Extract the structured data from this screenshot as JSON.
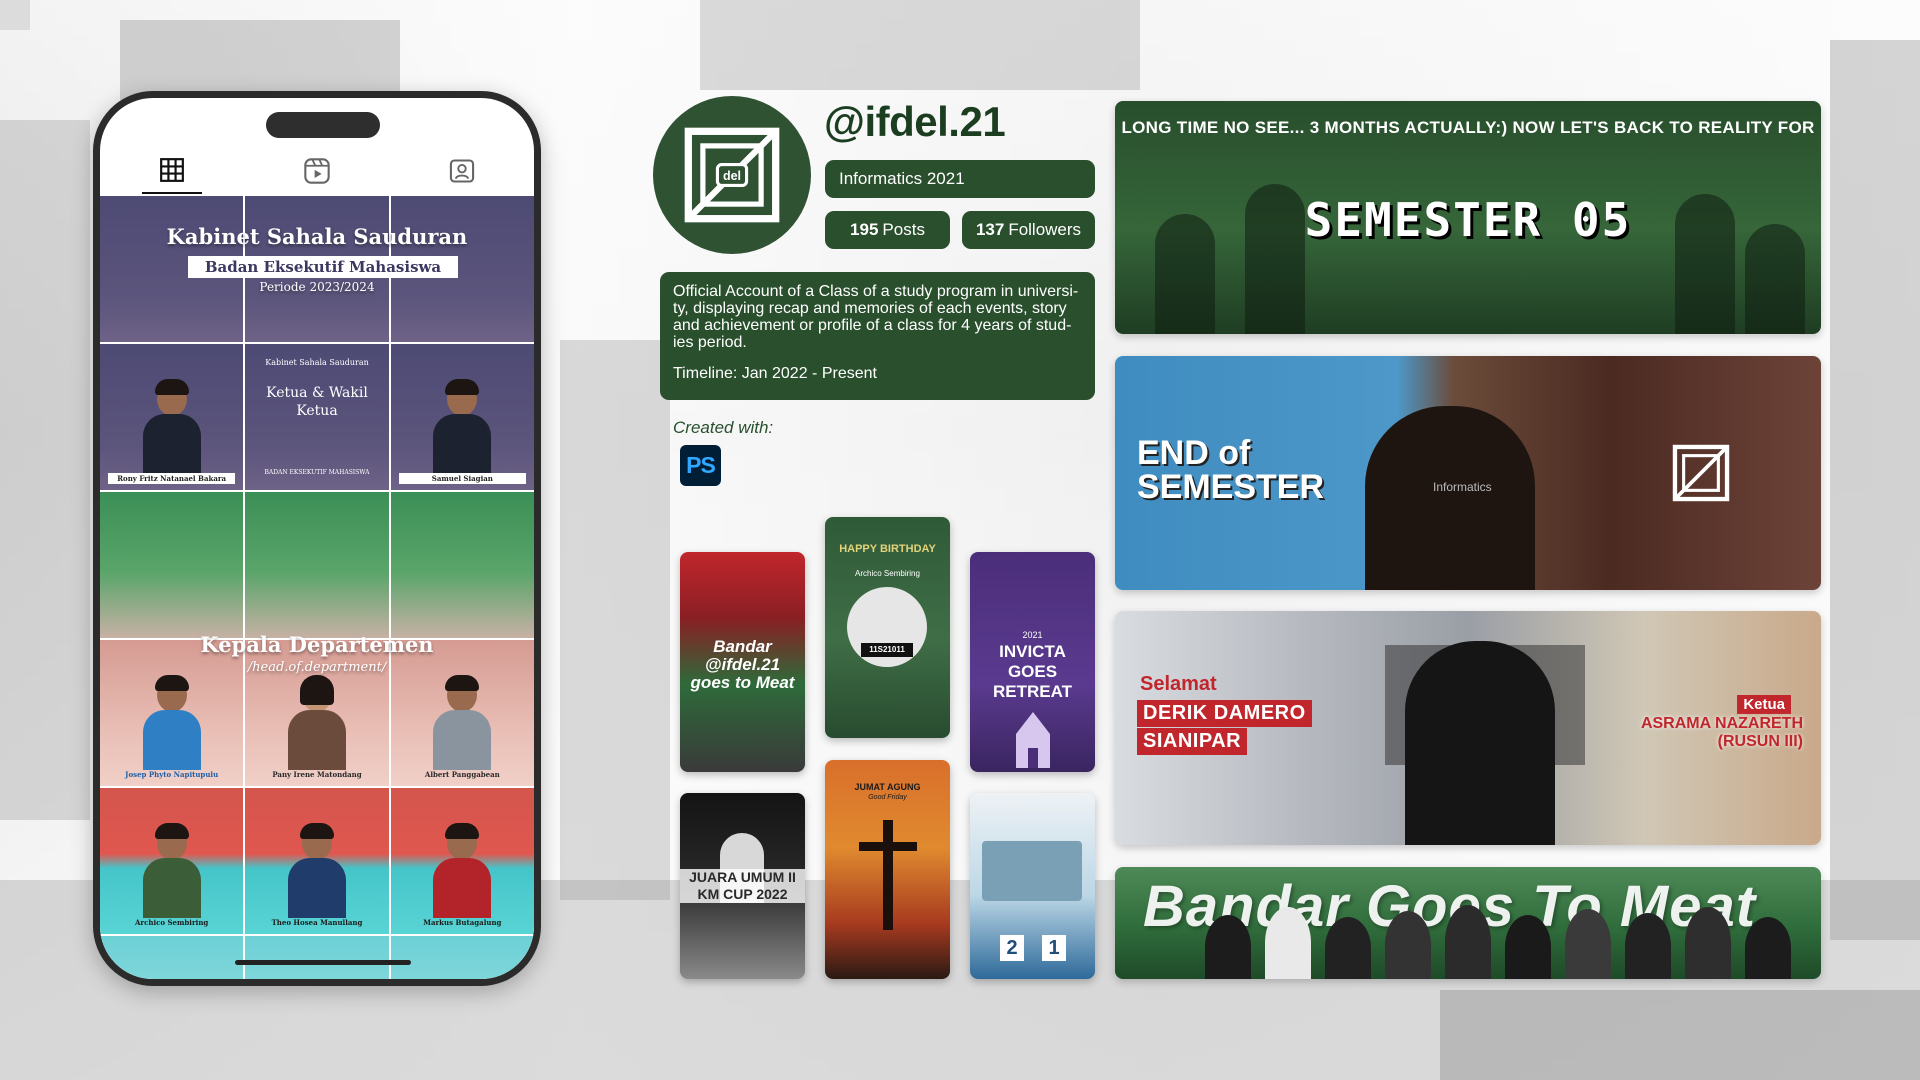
{
  "profile": {
    "handle": "@ifdel.21",
    "subtitle": "Informatics 2021",
    "posts_count": "195",
    "posts_label": "Posts",
    "followers_count": "137",
    "followers_label": "Followers",
    "avatar_logo_text": "del",
    "bio": "Official Account of a Class of a study program in universi-ty, displaying recap and memories of each events, story and achievement or profile of a class for 4 years of stud-ies period.",
    "timeline": "Timeline: Jan 2022 - Present",
    "created_with_label": "Created with:",
    "tool_icon": "PS"
  },
  "phone": {
    "tabs": [
      {
        "icon": "grid-icon"
      },
      {
        "icon": "reels-icon"
      },
      {
        "icon": "tagged-icon"
      }
    ],
    "grid": {
      "row1_title": "Kabinet Sahala Sauduran",
      "row1_subtitle": "Badan Eksekutif Mahasiswa",
      "row1_period": "Periode 2023/2024",
      "row2_center_small": "Kabinet Sahala Sauduran",
      "row2_center_main": "Ketua & Wakil Ketua",
      "row2_center_foot": "BADAN EKSEKUTIF MAHASISWA",
      "row2_left_name": "Rony Fritz Natanael Bakara",
      "row2_right_name": "Samuel Siagian",
      "row3_title": "Kepala Departemen",
      "row3_subtitle": "/head.of.department/",
      "row4_names": [
        "Josep Phyto Napitupulu",
        "Pany Irene Matondang",
        "Albert Panggabean"
      ],
      "row5_names": [
        "Archico Sembiring",
        "Theo Hosea Manullang",
        "Markus Butagalung"
      ]
    }
  },
  "posters": {
    "meat_title": "Bandar @ifdel.21 goes to Meat",
    "birthday_title": "HAPPY BIRTHDAY",
    "birthday_name": "Archico Sembiring",
    "birthday_id": "11S21011",
    "retreat_year": "2021",
    "retreat_title": "INVICTA GOES RETREAT",
    "juara_text": "JUARA UMUM II KM CUP 2022",
    "jumat_title": "JUMAT AGUNG",
    "jumat_sub": "Good Friday",
    "score_left": "2",
    "score_right": "1"
  },
  "banners": {
    "semester_intro": "LONG TIME NO SEE... 3 MONTHS ACTUALLY:) NOW LET'S BACK TO REALITY FOR",
    "semester_title": "SEMESTER 05",
    "eos_line1": "END of",
    "eos_line2": "SEMESTER",
    "eos_shirt": "Informatics",
    "congrats_word": "Selamat",
    "congrats_name1": "DERIK DAMERO",
    "congrats_name2": "SIANIPAR",
    "congrats_role": "Ketua",
    "congrats_asrama1": "ASRAMA NAZARETH",
    "congrats_asrama2": "(RUSUN III)",
    "meat_banner_title": "Bandar Goes To Meat"
  },
  "colors": {
    "brand_green": "#294f2d",
    "handle_green": "#1b3d20",
    "accent_red": "#c0262b"
  }
}
